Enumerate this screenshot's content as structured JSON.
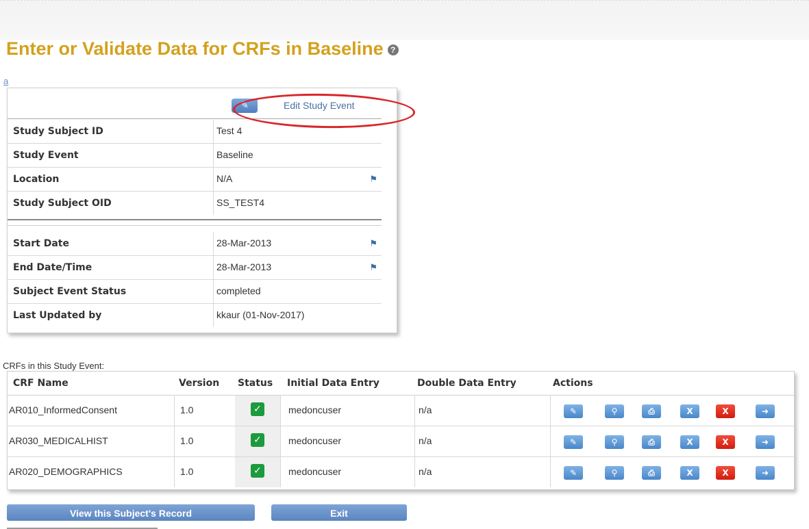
{
  "page": {
    "title": "Enter or Validate Data for CRFs in Baseline",
    "help_icon": "?",
    "back_link": "a"
  },
  "event": {
    "edit_label": "Edit Study Event",
    "rows": [
      {
        "label": "Study Subject ID",
        "value": "Test 4",
        "flag": false
      },
      {
        "label": "Study Event",
        "value": "Baseline",
        "flag": false
      },
      {
        "label": "Location",
        "value": "N/A",
        "flag": true
      },
      {
        "label": "Study Subject OID",
        "value": "SS_TEST4",
        "flag": false
      },
      {
        "label": "Start Date",
        "value": "28-Mar-2013",
        "flag": true
      },
      {
        "label": "End Date/Time",
        "value": "28-Mar-2013",
        "flag": true
      },
      {
        "label": "Subject Event Status",
        "value": "completed",
        "flag": false
      },
      {
        "label": "Last Updated by",
        "value": "kkaur (01-Nov-2017)",
        "flag": false
      }
    ]
  },
  "crfs": {
    "caption": "CRFs in this Study Event:",
    "headers": {
      "name": "CRF Name",
      "version": "Version",
      "status": "Status",
      "initial": "Initial Data Entry",
      "double": "Double Data Entry",
      "actions": "Actions"
    },
    "rows": [
      {
        "name": "AR010_InformedConsent",
        "version": "1.0",
        "initial": "medoncuser",
        "double": "n/a"
      },
      {
        "name": "AR030_MEDICALHIST",
        "version": "1.0",
        "initial": "medoncuser",
        "double": "n/a"
      },
      {
        "name": "AR020_DEMOGRAPHICS",
        "version": "1.0",
        "initial": "medoncuser",
        "double": "n/a"
      }
    ],
    "action_icons": [
      "edit-icon",
      "view-icon",
      "print-icon",
      "remove-icon",
      "delete-icon",
      "reassign-icon"
    ],
    "remove_glyph": "X",
    "delete_glyph": "X"
  },
  "buttons": {
    "view_record": "View this Subject's Record",
    "exit": "Exit"
  },
  "colors": {
    "title": "#d4a11e",
    "button": "#6a93cb",
    "delete": "#e02a1d",
    "status_ok": "#1c9a3e",
    "highlight": "#d9262a"
  }
}
